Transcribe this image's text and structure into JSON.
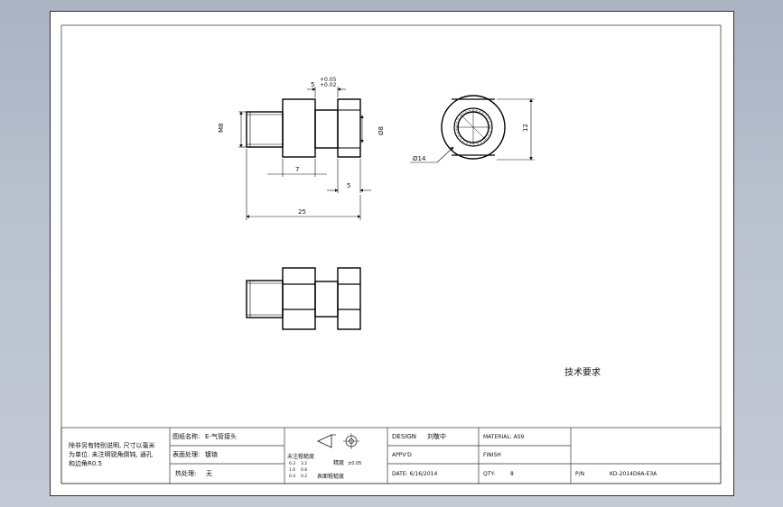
{
  "dims": {
    "m8": "M8",
    "tol_plus": "+0.05",
    "tol_minus": "+0.02",
    "d5_top": "5",
    "d7": "7",
    "d5_bottom": "5",
    "d25": "25",
    "phi8": "Ø8",
    "phi14": "Ø14",
    "d12": "12"
  },
  "tech_req": "技术要求",
  "title_block": {
    "notes": [
      "除非另有特别说明, 尺寸以毫米",
      "为单位. 未注明锐角倒钝, 通孔",
      "和边角R0.5"
    ],
    "part_name_label": "图纸名称:",
    "part_name": "E-气管接头",
    "surface_label": "表面处理:",
    "surface_value": "镀铬",
    "heat_label": "热处理:",
    "heat_value": "无",
    "rough_label": "未注粗糙度",
    "rough_vals": [
      "6.3",
      "3.2",
      "1.6",
      "0.8",
      "0.4",
      "0.2"
    ],
    "accuracy_label": "精度",
    "accuracy_value": "±0.05",
    "surface_rough_label": "表面粗糙度",
    "design_label": "DESIGN",
    "design_value": "刘敬中",
    "material": "MATERIAL: AS9",
    "approved": "APPV'D",
    "finish": "FINISH",
    "date": "DATE: 6/16/2014",
    "qty_label": "QTY:",
    "qty_value": "8",
    "pn_label": "P/N",
    "pn_value": "KD-2014D6A-E3A"
  }
}
